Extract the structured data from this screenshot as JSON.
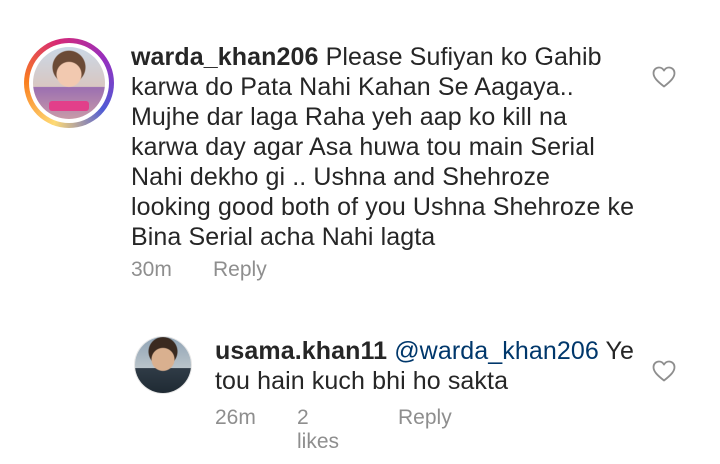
{
  "comments": [
    {
      "username": "warda_khan206",
      "text": "Please Sufiyan ko Gahib karwa do Pata Nahi Kahan Se Aagaya.. Mujhe dar laga Raha yeh aap ko kill na karwa day agar Asa huwa tou main Serial Nahi dekho gi .. Ushna and Shehroze looking good both of you Ushna Shehroze ke Bina Serial acha Nahi lagta",
      "time": "30m",
      "reply_label": "Reply"
    },
    {
      "username": "usama.khan11",
      "mention": "@warda_khan206",
      "text": "Ye tou hain kuch bhi ho sakta",
      "time": "26m",
      "likes": "2 likes",
      "reply_label": "Reply"
    }
  ],
  "colors": {
    "text": "#262626",
    "meta": "#8e8e8e",
    "mention": "#00376b"
  },
  "icons": {
    "like": "heart-outline-icon"
  }
}
